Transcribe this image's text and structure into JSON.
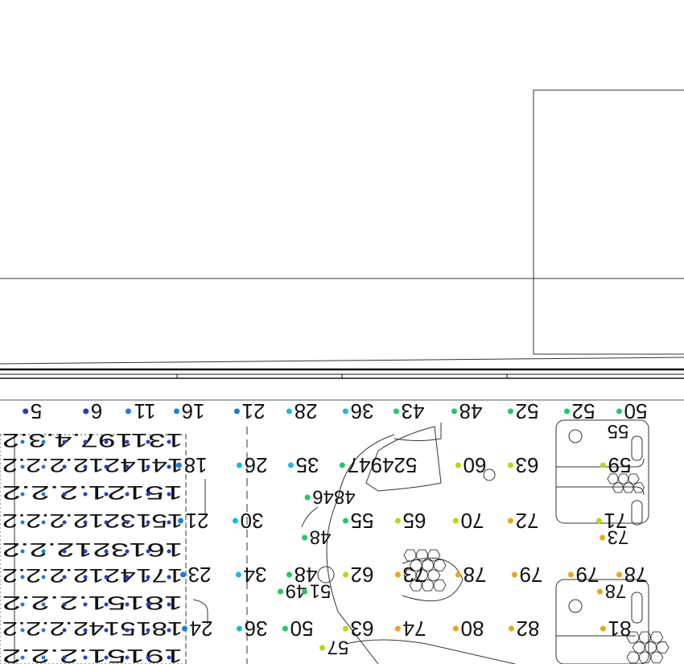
{
  "colors": {
    "background": "#ffffff",
    "linework": "#333333",
    "label_text": "#111111",
    "scale": [
      "#1e3fd0",
      "#1a7fe0",
      "#18b8e6",
      "#22c95a",
      "#b8d61c",
      "#f0a318",
      "#e8421c"
    ]
  },
  "row1": [
    {
      "label": "5",
      "level": 0.04
    },
    {
      "label": "6",
      "level": 0.05
    },
    {
      "label": "11",
      "level": 0.1
    },
    {
      "label": "16",
      "level": 0.16
    },
    {
      "label": "21",
      "level": 0.21
    },
    {
      "label": "28",
      "level": 0.28
    },
    {
      "label": "36",
      "level": 0.36
    },
    {
      "label": "43",
      "level": 0.43
    },
    {
      "label": "48",
      "level": 0.5
    },
    {
      "label": "52",
      "level": 0.56
    },
    {
      "label": "52",
      "level": 0.56
    },
    {
      "label": "50",
      "level": 0.54
    }
  ],
  "row3": [
    {
      "label": "18",
      "level": 0.17
    },
    {
      "label": "26",
      "level": 0.26
    },
    {
      "label": "35",
      "level": 0.35
    },
    {
      "label": "524947",
      "level": 0.54
    },
    {
      "label": "60",
      "level": 0.62
    },
    {
      "label": "63",
      "level": 0.65
    },
    {
      "label": "59",
      "level": 0.63
    }
  ],
  "row4": [
    {
      "label": "4846",
      "level": 0.5
    }
  ],
  "row5": [
    {
      "label": "21",
      "level": 0.21
    },
    {
      "label": "30",
      "level": 0.3
    },
    {
      "label": "55",
      "level": 0.58
    },
    {
      "label": "65",
      "level": 0.67
    },
    {
      "label": "70",
      "level": 0.72
    },
    {
      "label": "72",
      "level": 0.75
    },
    {
      "label": "71",
      "level": 0.74
    }
  ],
  "row6": [
    {
      "label": "48",
      "level": 0.5
    },
    {
      "label": "73",
      "level": 0.77
    }
  ],
  "row7": [
    {
      "label": "23",
      "level": 0.22
    },
    {
      "label": "34",
      "level": 0.34
    },
    {
      "label": "48",
      "level": 0.5
    },
    {
      "label": "62",
      "level": 0.64
    },
    {
      "label": "73",
      "level": 0.77
    },
    {
      "label": "78",
      "level": 0.82
    },
    {
      "label": "79",
      "level": 0.84
    },
    {
      "label": "79",
      "level": 0.84
    },
    {
      "label": "78",
      "level": 0.82
    }
  ],
  "row8": [
    {
      "label": "49",
      "level": 0.5
    },
    {
      "label": "51",
      "level": 0.53
    },
    {
      "label": "78",
      "level": 0.82
    }
  ],
  "row9": [
    {
      "label": "24",
      "level": 0.23
    },
    {
      "label": "36",
      "level": 0.36
    },
    {
      "label": "50",
      "level": 0.52
    },
    {
      "label": "63",
      "level": 0.65
    },
    {
      "label": "74",
      "level": 0.78
    },
    {
      "label": "80",
      "level": 0.86
    },
    {
      "label": "82",
      "level": 0.9
    },
    {
      "label": "81",
      "level": 0.88
    }
  ],
  "row10": [
    {
      "label": "57",
      "level": 0.6
    }
  ],
  "row2_left": "131197.4.3.2",
  "left_grid": [
    "1414212.2.2.2",
    "15121.2.2.2",
    "1513212.2.2.2",
    "1613212.2.2",
    "1714212.2.2.2",
    "18151.2.2.2",
    "1815142.2.2.2",
    "19151.2.2.2"
  ],
  "row9_right_small": "55"
}
